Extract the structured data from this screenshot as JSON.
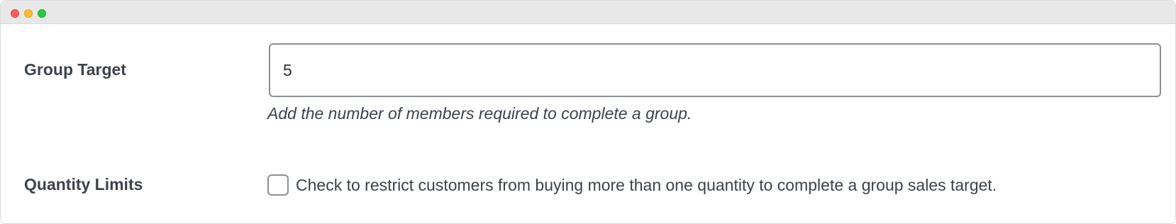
{
  "window": {
    "controls": [
      "close",
      "minimize",
      "maximize"
    ]
  },
  "fields": {
    "group_target": {
      "label": "Group Target",
      "value": "5",
      "description": "Add the number of members required to complete a group."
    },
    "quantity_limits": {
      "label": "Quantity Limits",
      "checked": false,
      "checkbox_label": "Check to restrict customers from buying more than one quantity to complete a group sales target."
    }
  },
  "colors": {
    "text": "#3c434a",
    "input_border": "#8c8f94",
    "titlebar": "#e8e8e8"
  }
}
